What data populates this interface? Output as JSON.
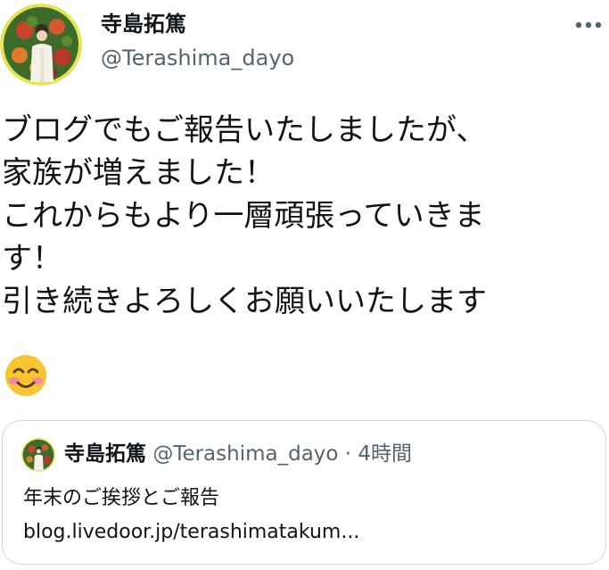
{
  "tweet": {
    "display_name": "寺島拓篤",
    "handle": "@Terashima_dayo",
    "more_icon": "more-horizontal-icon",
    "text": "ブログでもご報告いたしましたが、\n家族が増えました！\nこれからもより一層頑張っていきま\nす！\n引き続きよろしくお願いいたします",
    "emoji": "smiling-face-with-smiling-eyes-emoji"
  },
  "quote": {
    "display_name": "寺島拓篤",
    "handle": "@Terashima_dayo",
    "separator": "·",
    "time": "4時間",
    "text": "年末のご挨拶とご報告",
    "link": "blog.livedoor.jp/terashimatakum..."
  },
  "colors": {
    "text_primary": "#0f1419",
    "text_secondary": "#536471",
    "border": "#cfd9de",
    "emoji_face": "#f7c531",
    "emoji_blush": "#f48aa0"
  }
}
